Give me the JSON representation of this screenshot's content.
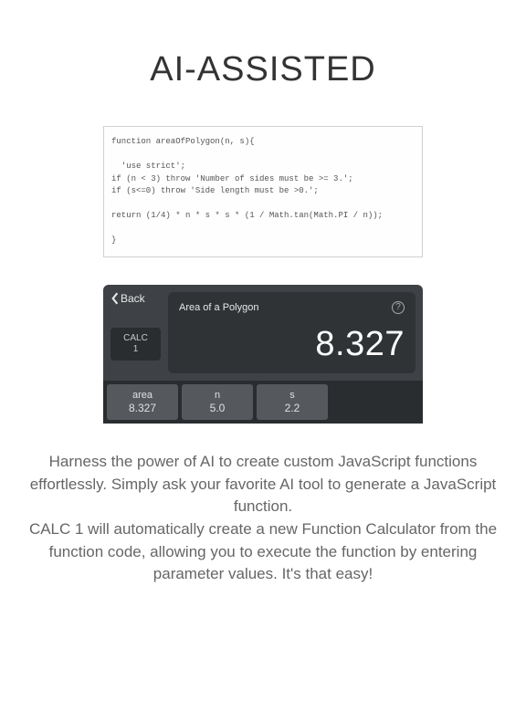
{
  "title": "AI-ASSISTED",
  "code": "function areaOfPolygon(n, s){\n\n  'use strict';\nif (n < 3) throw 'Number of sides must be >= 3.';\nif (s<=0) throw 'Side length must be >0.';\n\nreturn (1/4) * n * s * s * (1 / Math.tan(Math.PI / n));\n\n}",
  "calc": {
    "back": "Back",
    "calc1_line1": "CALC",
    "calc1_line2": "1",
    "display_title": "Area of a Polygon",
    "help": "?",
    "result": "8.327",
    "params": [
      {
        "label": "area",
        "value": "8.327"
      },
      {
        "label": "n",
        "value": "5.0"
      },
      {
        "label": "s",
        "value": "2.2"
      }
    ]
  },
  "description": "Harness the power of AI to create custom JavaScript functions effortlessly. Simply ask your favorite AI tool to generate a JavaScript function.\nCALC 1 will automatically create a new Function Calculator from the function code, allowing you to execute the function by entering parameter values. It's that easy!"
}
